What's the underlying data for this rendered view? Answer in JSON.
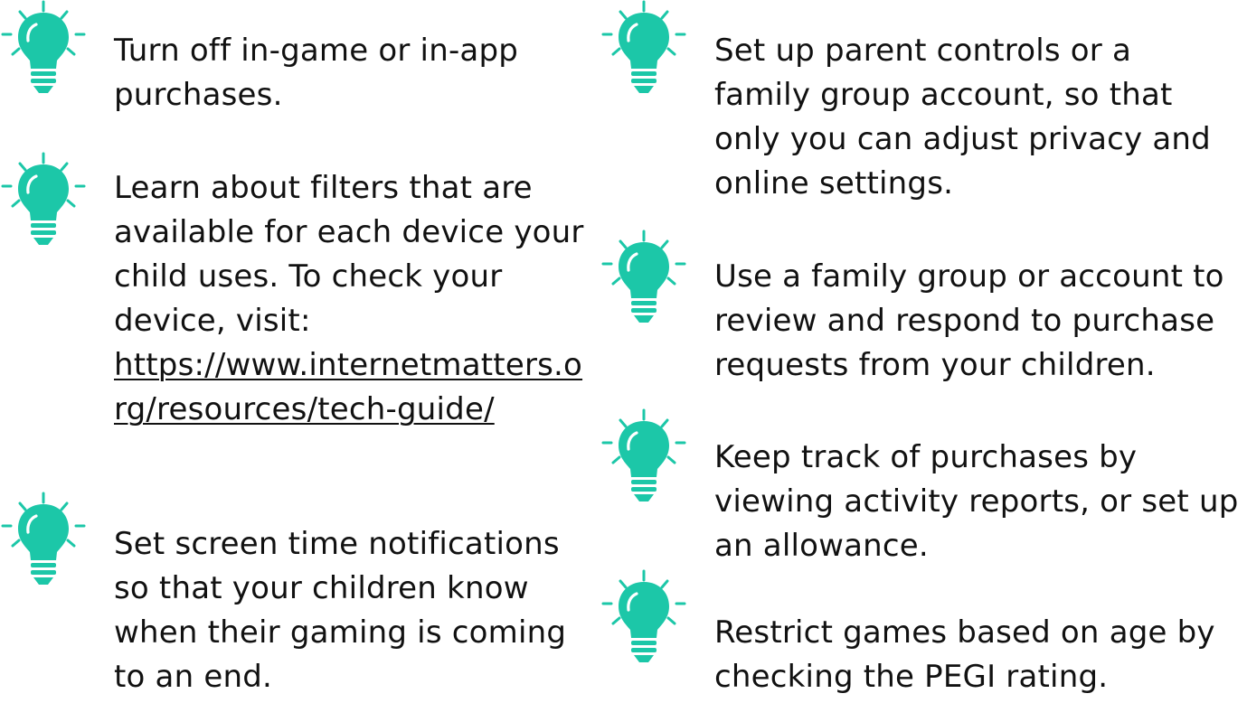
{
  "colors": {
    "bulb": "#1cc7a8",
    "text": "#111111",
    "background": "#ffffff"
  },
  "icon": "lightbulb-icon",
  "left_column": [
    {
      "lines": [
        "Turn off in-game or in-app",
        "purchases."
      ]
    },
    {
      "lines": [
        "Learn about filters that are",
        "available for each device your",
        "child uses. To check your",
        "device, visit:"
      ],
      "link_lines": [
        "https://www.internetmatters.o",
        "rg/resources/tech-guide/"
      ]
    },
    {
      "lines": [
        "Set screen time notifications",
        "so that your children know",
        "when their gaming is coming",
        "to an end."
      ]
    }
  ],
  "right_column": [
    {
      "lines": [
        "Set up parent controls or a",
        "family group account, so that",
        "only you can adjust privacy and",
        "online settings."
      ]
    },
    {
      "lines": [
        "Use a family group or account to",
        "review and respond to purchase",
        "requests from your children."
      ]
    },
    {
      "lines": [
        "Keep track of purchases by",
        "viewing activity reports, or set up",
        "an allowance."
      ]
    },
    {
      "lines": [
        "Restrict games based on age by",
        "checking the PEGI rating."
      ]
    }
  ]
}
